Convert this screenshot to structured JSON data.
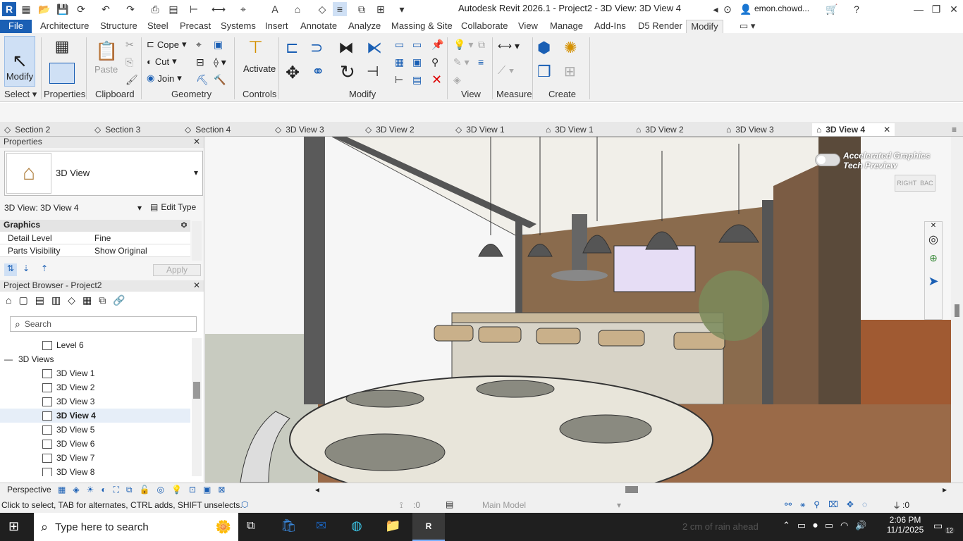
{
  "app": {
    "title": "Autodesk Revit 2026.1 - Project2 - 3D View: 3D View 4",
    "user": "emon.chowd..."
  },
  "ribbon_tabs": [
    "File",
    "Architecture",
    "Structure",
    "Steel",
    "Precast",
    "Systems",
    "Insert",
    "Annotate",
    "Analyze",
    "Massing & Site",
    "Collaborate",
    "View",
    "Manage",
    "Add-Ins",
    "D5 Render",
    "Modify"
  ],
  "ribbon": {
    "modify_label": "Modify",
    "properties_label": "Properties",
    "paste_label": "Paste",
    "cope_label": "Cope",
    "cut_label": "Cut",
    "join_label": "Join",
    "activate_label": "Activate",
    "panels": {
      "select": "Select",
      "properties": "Properties",
      "clipboard": "Clipboard",
      "geometry": "Geometry",
      "controls": "Controls",
      "modify": "Modify",
      "view": "View",
      "measure": "Measure",
      "create": "Create"
    }
  },
  "view_tabs": [
    "Section 2",
    "Section 3",
    "Section 4",
    "3D View 3",
    "3D View 2",
    "3D View 1",
    "3D View 1",
    "3D View 2",
    "3D View 3",
    "3D View 4"
  ],
  "properties_panel": {
    "title": "Properties",
    "type_name": "3D View",
    "instance": "3D View: 3D View 4",
    "edit_type": "Edit Type",
    "section": "Graphics",
    "rows": [
      {
        "name": "Detail Level",
        "value": "Fine"
      },
      {
        "name": "Parts Visibility",
        "value": "Show Original"
      }
    ],
    "apply": "Apply"
  },
  "project_browser": {
    "title": "Project Browser - Project2",
    "search_placeholder": "Search",
    "items": [
      {
        "label": "Level 6",
        "indent": 2,
        "kind": "view"
      },
      {
        "label": "3D Views",
        "indent": 1,
        "kind": "group"
      },
      {
        "label": "3D View 1",
        "indent": 2,
        "kind": "view"
      },
      {
        "label": "3D View 2",
        "indent": 2,
        "kind": "view"
      },
      {
        "label": "3D View 3",
        "indent": 2,
        "kind": "view"
      },
      {
        "label": "3D View 4",
        "indent": 2,
        "kind": "view",
        "selected": true
      },
      {
        "label": "3D View 5",
        "indent": 2,
        "kind": "view"
      },
      {
        "label": "3D View 6",
        "indent": 2,
        "kind": "view"
      },
      {
        "label": "3D View 7",
        "indent": 2,
        "kind": "view"
      },
      {
        "label": "3D View 8",
        "indent": 2,
        "kind": "view"
      }
    ]
  },
  "viewport": {
    "accelerated_graphics": "Accelerated Graphics Tech Preview",
    "viewcube_right": "RIGHT",
    "viewcube_back": "BAC"
  },
  "status": {
    "view_mode": "Perspective",
    "hint": "Click to select, TAB for alternates, CTRL adds, SHIFT unselects.",
    "selection_count": ":0",
    "model": "Main Model",
    "filter_count": ":0"
  },
  "taskbar": {
    "search_placeholder": "Type here to search",
    "weather": "2 cm of rain ahead",
    "time": "2:06 PM",
    "date": "11/1/2025",
    "notification_count": "12"
  },
  "colors": {
    "file_tab": "#1a5fb4",
    "taskbar": "#1f1f1f",
    "selection": "#e6eef8"
  }
}
